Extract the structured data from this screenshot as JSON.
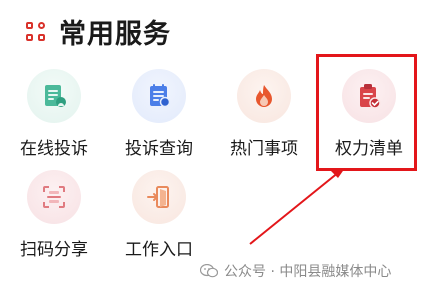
{
  "header": {
    "title": "常用服务"
  },
  "services": [
    {
      "label": "在线投诉",
      "icon": "complaint-doc-icon"
    },
    {
      "label": "投诉查询",
      "icon": "query-list-icon"
    },
    {
      "label": "热门事项",
      "icon": "flame-icon"
    },
    {
      "label": "权力清单",
      "icon": "clipboard-check-icon"
    },
    {
      "label": "扫码分享",
      "icon": "scan-code-icon"
    },
    {
      "label": "工作入口",
      "icon": "door-enter-icon"
    }
  ],
  "watermark": {
    "text": "公众号 · 中阳县融媒体中心"
  },
  "colors": {
    "accent": "#d9322b",
    "highlight": "#e3161a",
    "arrow": "#e3161a"
  }
}
